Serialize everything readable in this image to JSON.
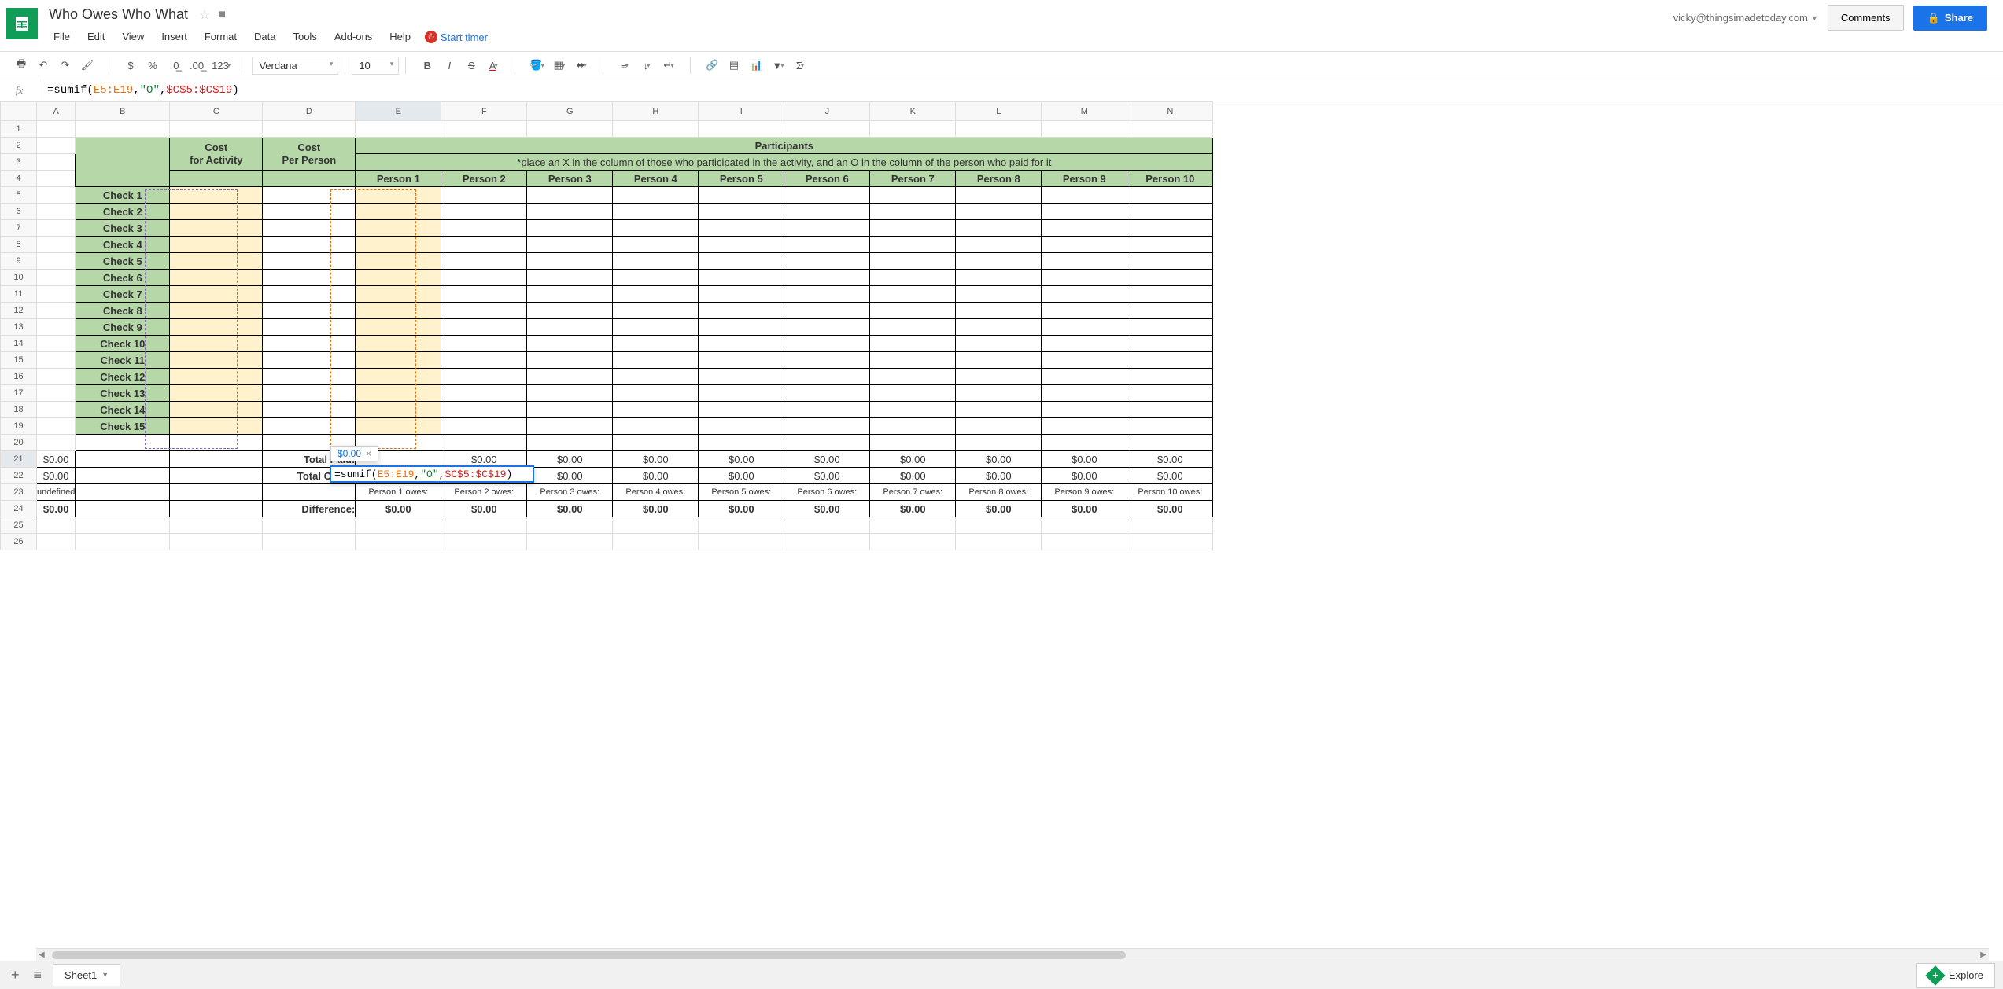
{
  "doc_title": "Who Owes Who What",
  "user_email": "vicky@thingsimadetoday.com",
  "comments_btn": "Comments",
  "share_btn": "Share",
  "menus": [
    "File",
    "Edit",
    "View",
    "Insert",
    "Format",
    "Data",
    "Tools",
    "Add-ons",
    "Help"
  ],
  "timer_label": "Start timer",
  "toolbar": {
    "font": "Verdana",
    "size": "10",
    "fmt_123": "123"
  },
  "formula_parts": {
    "prefix": "=sumif(",
    "range1": "E5:E19",
    "comma1": ",",
    "str": "\"O\"",
    "comma2": ",",
    "range2": "$C$5:$C$19",
    "suffix": ")"
  },
  "hint_value": "$0.00",
  "columns": [
    "A",
    "B",
    "C",
    "D",
    "E",
    "F",
    "G",
    "H",
    "I",
    "J",
    "K",
    "L",
    "M",
    "N"
  ],
  "row_nums": [
    1,
    2,
    3,
    4,
    5,
    6,
    7,
    8,
    9,
    10,
    11,
    12,
    13,
    14,
    15,
    16,
    17,
    18,
    19,
    20,
    21,
    22,
    23,
    24,
    25,
    26
  ],
  "headers": {
    "participants": "Participants",
    "instruction": "*place an X in the column of those who participated in the activity, and an O in the column of the person who paid for it",
    "cost_for_activity": "Cost for Activity",
    "cost_per_person": "Cost Per Person",
    "persons": [
      "Person 1",
      "Person 2",
      "Person 3",
      "Person 4",
      "Person 5",
      "Person 6",
      "Person 7",
      "Person 8",
      "Person 9",
      "Person 10"
    ]
  },
  "checks": [
    "Check 1",
    "Check 2",
    "Check 3",
    "Check 4",
    "Check 5",
    "Check 6",
    "Check 7",
    "Check 8",
    "Check 9",
    "Check 10",
    "Check 11",
    "Check 12",
    "Check 13",
    "Check 14",
    "Check 15"
  ],
  "summary": {
    "total_paid": "Total Paid:",
    "total_owed": "Total Owed:",
    "difference": "Difference:",
    "zero": "$0.00",
    "owes": [
      "Person 1 owes:",
      "Person 2 owes:",
      "Person 3 owes:",
      "Person 4 owes:",
      "Person 5 owes:",
      "Person 6 owes:",
      "Person 7 owes:",
      "Person 8 owes:",
      "Person 9 owes:",
      "Person 10 owes:"
    ]
  },
  "sheet_tab": "Sheet1",
  "explore": "Explore",
  "active_col": "E",
  "active_row": 21
}
